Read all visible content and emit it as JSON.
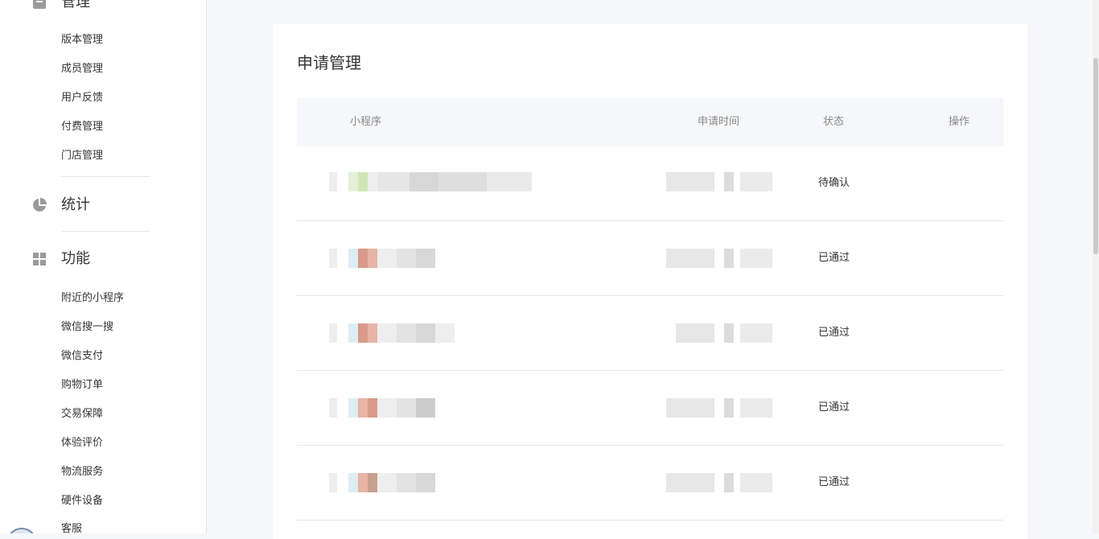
{
  "sidebar": {
    "manage_section": {
      "title": "管理",
      "icon": "manage-icon"
    },
    "manage_items": [
      "版本管理",
      "成员管理",
      "用户反馈",
      "付费管理",
      "门店管理"
    ],
    "stats_section": {
      "title": "统计",
      "icon": "pie-chart-icon"
    },
    "func_section": {
      "title": "功能",
      "icon": "grid-icon"
    },
    "func_items": [
      "附近的小程序",
      "微信搜一搜",
      "微信支付",
      "购物订单",
      "交易保障",
      "体验评价",
      "物流服务",
      "硬件设备",
      "客服"
    ]
  },
  "main": {
    "title": "申请管理",
    "columns": {
      "mini_program": "小程序",
      "apply_time": "申请时间",
      "status": "状态",
      "action": "操作"
    },
    "rows": [
      {
        "status": "待确认"
      },
      {
        "status": "已通过"
      },
      {
        "status": "已通过"
      },
      {
        "status": "已通过"
      },
      {
        "status": "已通过"
      }
    ]
  },
  "colors": {
    "accent_bg": "#f6f7f9",
    "border": "#e7e7eb",
    "text": "#353535",
    "muted": "#888888"
  }
}
